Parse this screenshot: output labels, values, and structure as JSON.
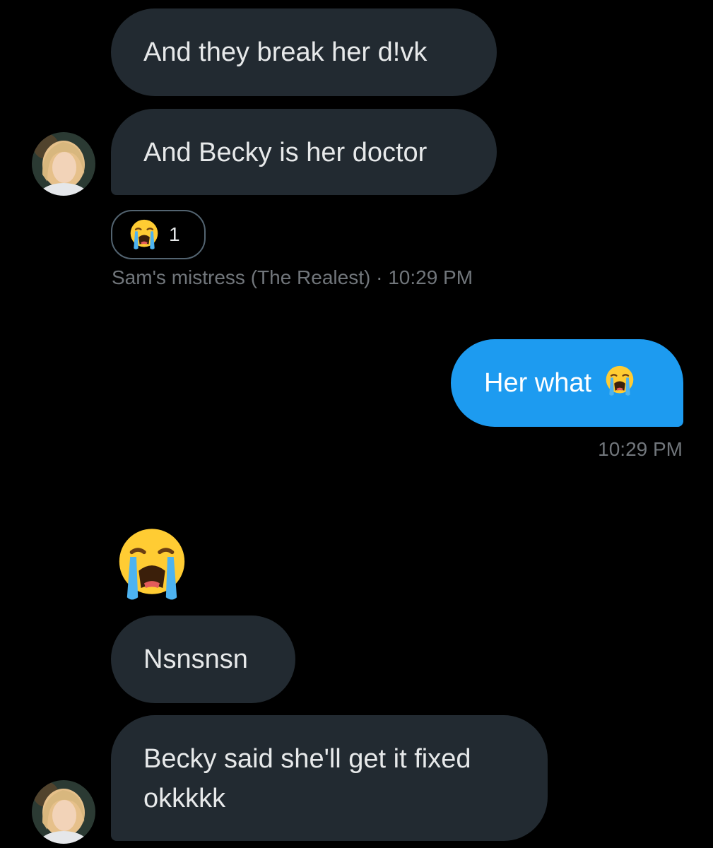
{
  "messages": [
    {
      "text": "And they break her d!vk"
    },
    {
      "text": "And Becky is her doctor"
    },
    {
      "text": "Her what"
    },
    {
      "text": "Nsnsnsn"
    },
    {
      "text": "Becky said she'll get it fixed okkkkk"
    }
  ],
  "reaction": {
    "emoji_icon": "loudly-crying-face-icon",
    "count": "1"
  },
  "meta_1": {
    "sender": "Sam's mistress (The Realest)",
    "separator": "·",
    "time": "10:29 PM"
  },
  "meta_2": {
    "time": "10:29 PM"
  },
  "emoji_message": {
    "icon": "loudly-crying-face-icon"
  },
  "colors": {
    "background": "#000000",
    "incoming_bubble": "#222a31",
    "outgoing_bubble": "#1d9bf0",
    "meta_text": "#71767b"
  }
}
